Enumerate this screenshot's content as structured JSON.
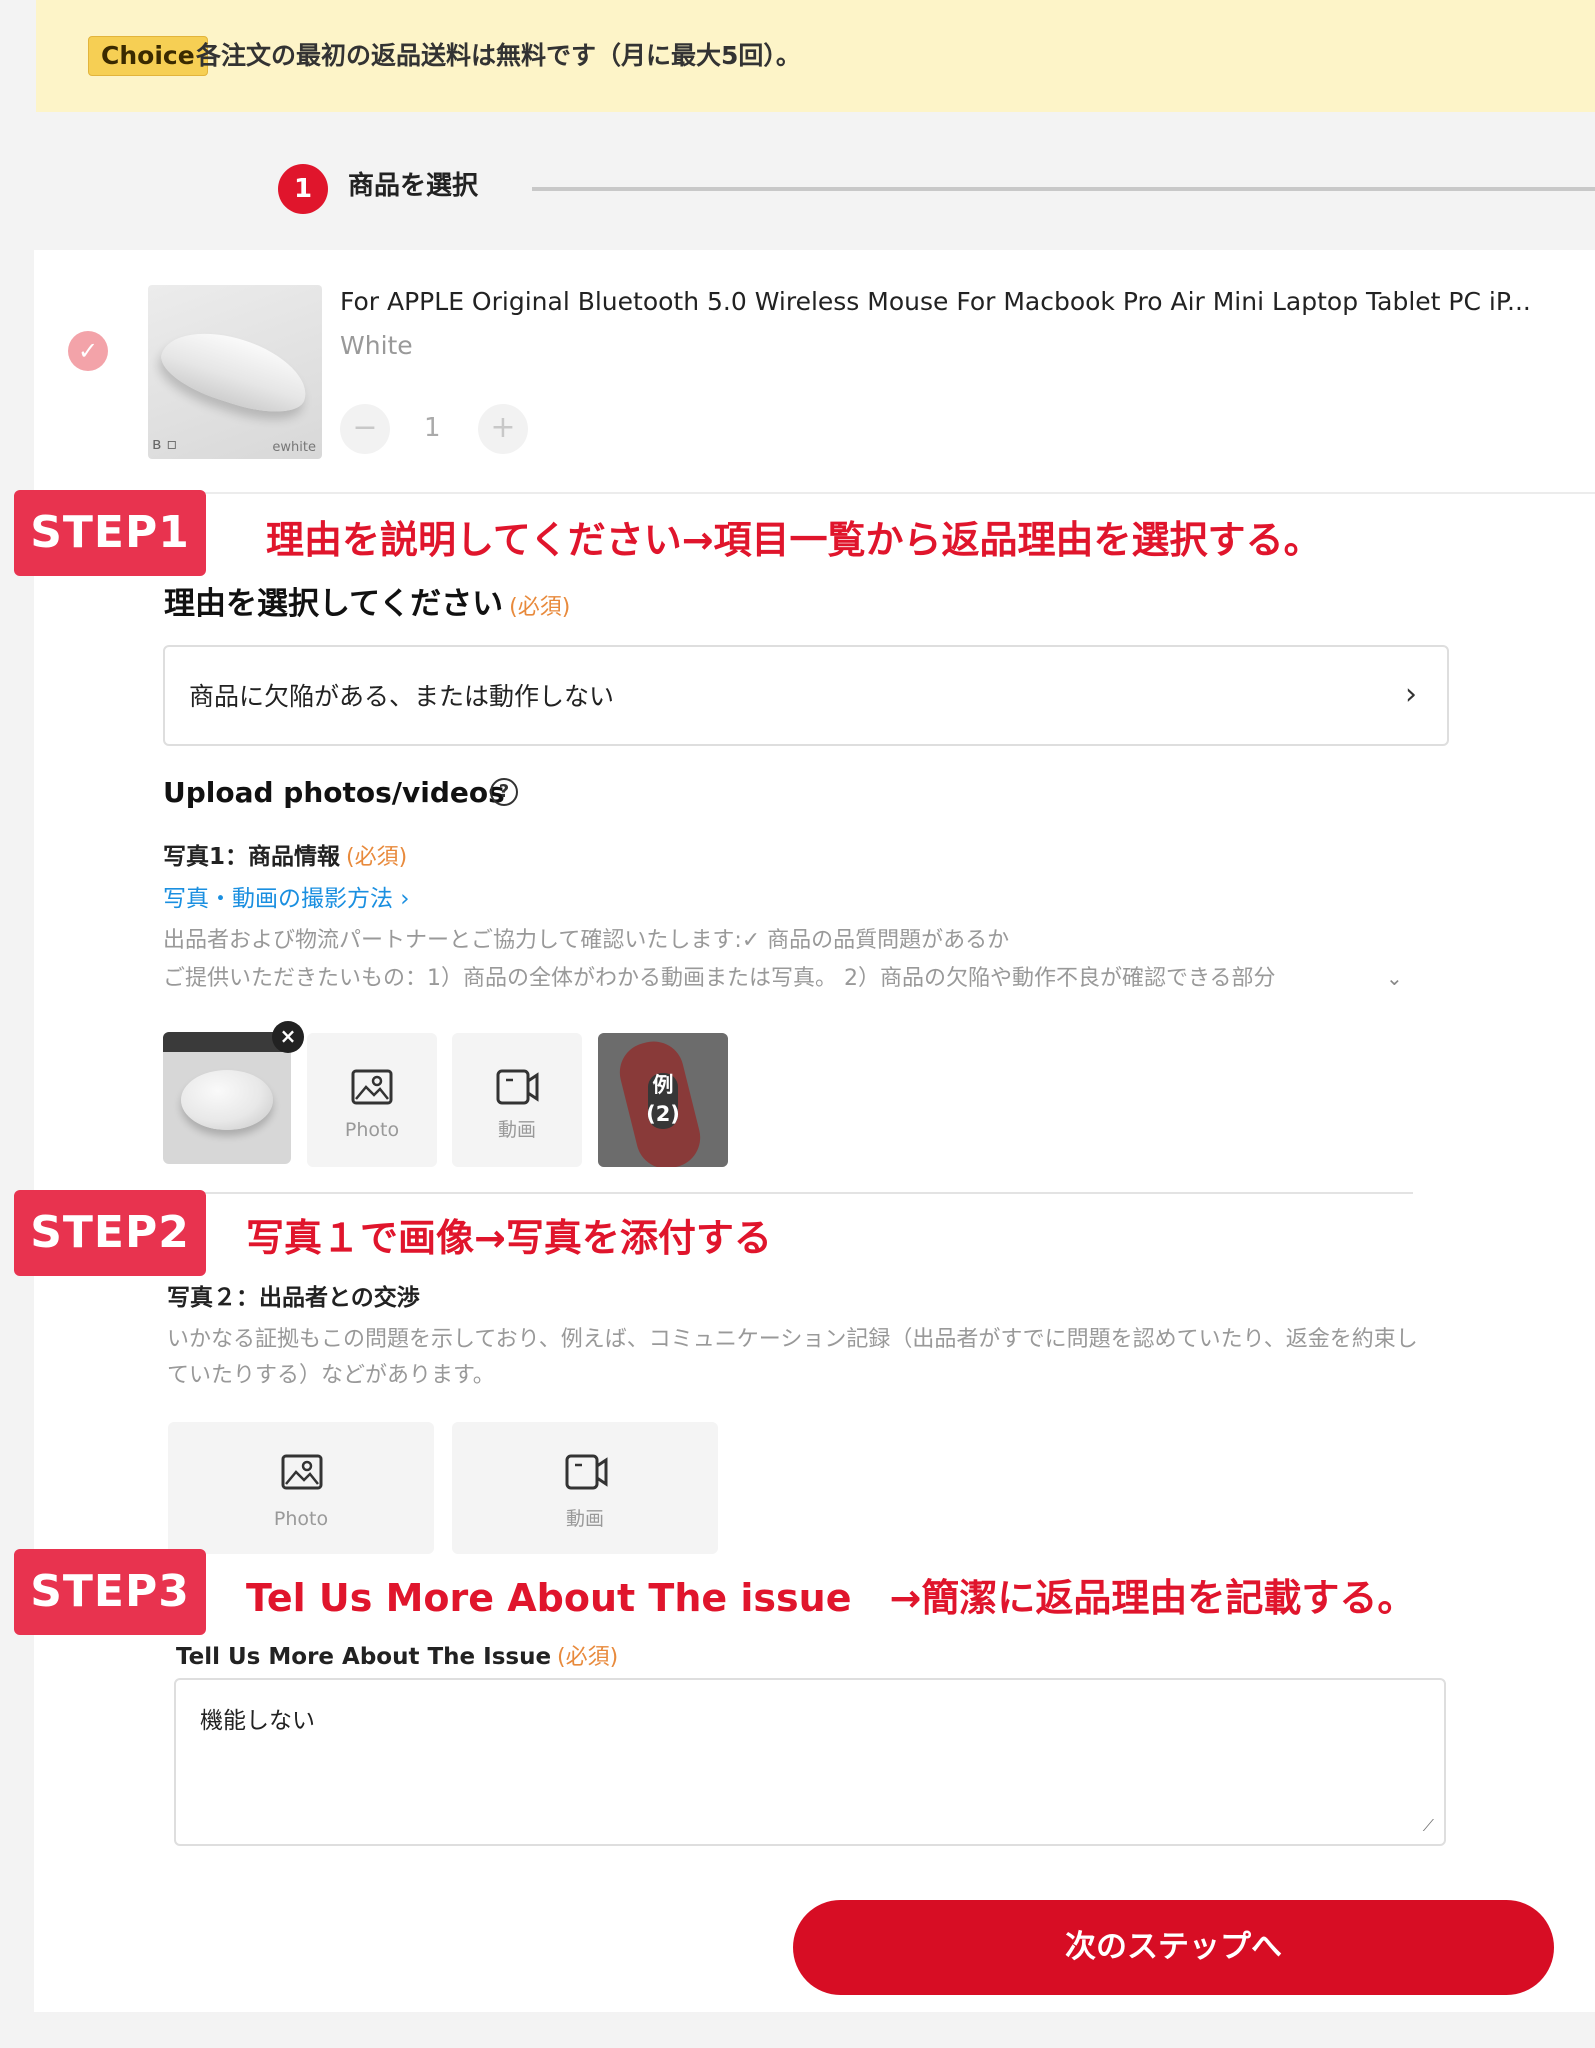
{
  "notice": {
    "badge": "Choice",
    "text": "各注文の最初の返品送料は無料です（月に最大5回）。"
  },
  "progress": {
    "step_number": "1",
    "step_label": "商品を選択"
  },
  "product": {
    "title": "For APPLE Original Bluetooth 5.0 Wireless Mouse For Macbook Pro Air Mini Laptop Tablet PC iP...",
    "variant": "White",
    "quantity": "1",
    "minus": "−",
    "plus": "+",
    "thumb_caption": "ewhite"
  },
  "annotations": {
    "step1": {
      "badge": "STEP1",
      "text": "理由を説明してください→項目一覧から返品理由を選択する。"
    },
    "step2": {
      "badge": "STEP2",
      "text": "写真１で画像→写真を添付する"
    },
    "step3": {
      "badge": "STEP3",
      "text": "Tel Us More About The issue　→簡潔に返品理由を記載する。"
    }
  },
  "reason": {
    "heading": "理由を選択してください",
    "required": "(必須)",
    "value": "商品に欠陥がある、または動作しない"
  },
  "upload": {
    "heading": "Upload photos/videos",
    "help": "?",
    "photo1": {
      "heading": "写真1：商品情報",
      "required": "(必須)",
      "tips_link": "写真・動画の撮影方法 ›",
      "desc_line1": "出品者および物流パートナーとご協力して確認いたします:✓ 商品の品質問題があるか",
      "desc_line2": "ご提供いただきたいもの：1）商品の全体がわかる動画または写真。 2）商品の欠陥や動作不良が確認できる部分",
      "remove": "×",
      "photo_label": "Photo",
      "video_label": "動画",
      "example_label": "例\n(2)"
    },
    "photo2": {
      "heading": "写真２：出品者との交渉",
      "desc": "いかなる証拠もこの問題を示しており、例えば、コミュニケーション記録（出品者がすでに問題を認めていたり、返金を約束していたりする）などがあります。",
      "photo_label": "Photo",
      "video_label": "動画"
    }
  },
  "issue": {
    "label": "Tell Us More About The Issue",
    "required": "(必須)",
    "value": "機能しない"
  },
  "next_button": "次のステップへ",
  "colors": {
    "accent": "#e0152c",
    "annotation_badge": "#e8334f",
    "banner": "#fdf4c8",
    "link": "#1a8fe0",
    "required": "#e88a3c"
  }
}
